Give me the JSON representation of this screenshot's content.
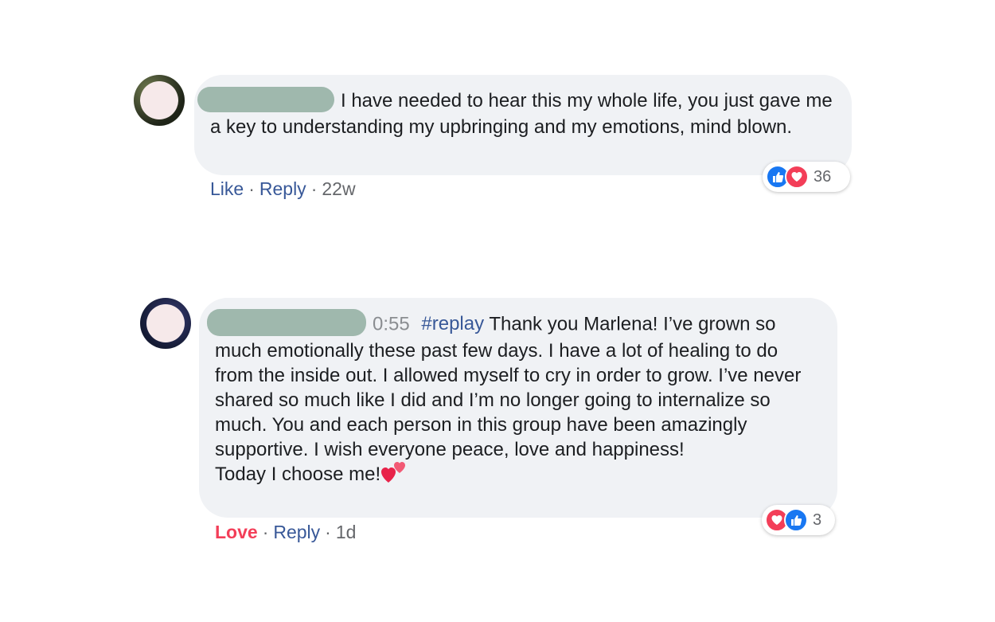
{
  "comments": [
    {
      "text": "I have needed to hear this my whole life, you just gave me a key to understanding my upbringing and my emotions, mind blown.",
      "reactions": {
        "icons": [
          "like-icon",
          "love-icon"
        ],
        "count": "36"
      },
      "actions": {
        "like": "Like",
        "reply": "Reply",
        "time": "22w",
        "sep": "·"
      }
    },
    {
      "timecode": "0:55",
      "hashtag": "#replay",
      "text_lines": [
        "Thank you Marlena! I’ve grown so much emotionally these past few days. I have a lot of healing to do from the inside out. I allowed myself to cry in order to grow. I’ve never shared so much like I did and I’m no longer going to internalize so much. You and each person in this group have been amazingly supportive. I wish everyone peace, love and happiness!",
        "Today I choose me!"
      ],
      "emoji": "two-hearts-icon",
      "reactions": {
        "icons": [
          "love-icon",
          "like-icon"
        ],
        "count": "3"
      },
      "actions": {
        "like": "Love",
        "reply": "Reply",
        "time": "1d",
        "sep": "·"
      }
    }
  ],
  "colors": {
    "link": "#385898",
    "love": "#f33e58",
    "like": "#1877f2",
    "bubble": "#f0f2f5",
    "meta": "#65676b"
  }
}
